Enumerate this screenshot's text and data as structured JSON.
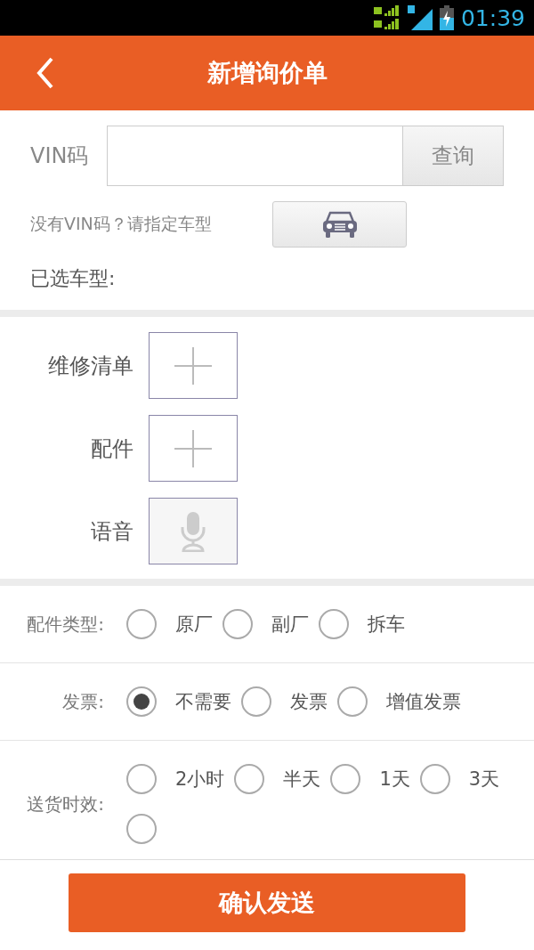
{
  "status_bar": {
    "time": "01:39"
  },
  "header": {
    "title": "新增询价单"
  },
  "vin": {
    "label": "VIN码",
    "button": "查询"
  },
  "model_hint": "没有VIN码？请指定车型",
  "selected_model_label": "已选车型:",
  "attachments": [
    {
      "label": "维修清单",
      "kind": "add"
    },
    {
      "label": "配件",
      "kind": "add"
    },
    {
      "label": "语音",
      "kind": "voice"
    }
  ],
  "option_groups": [
    {
      "label": "配件类型:",
      "options": [
        {
          "label": "原厂",
          "selected": false
        },
        {
          "label": "副厂",
          "selected": false
        },
        {
          "label": "拆车",
          "selected": false
        }
      ]
    },
    {
      "label": "发票:",
      "options": [
        {
          "label": "不需要",
          "selected": true
        },
        {
          "label": "发票",
          "selected": false
        },
        {
          "label": "增值发票",
          "selected": false
        }
      ]
    },
    {
      "label": "送货时效:",
      "options": [
        {
          "label": "2小时",
          "selected": false
        },
        {
          "label": "半天",
          "selected": false
        },
        {
          "label": "1天",
          "selected": false
        },
        {
          "label": "3天",
          "selected": false
        },
        {
          "selected": false
        }
      ]
    }
  ],
  "confirm_button": "确认发送"
}
